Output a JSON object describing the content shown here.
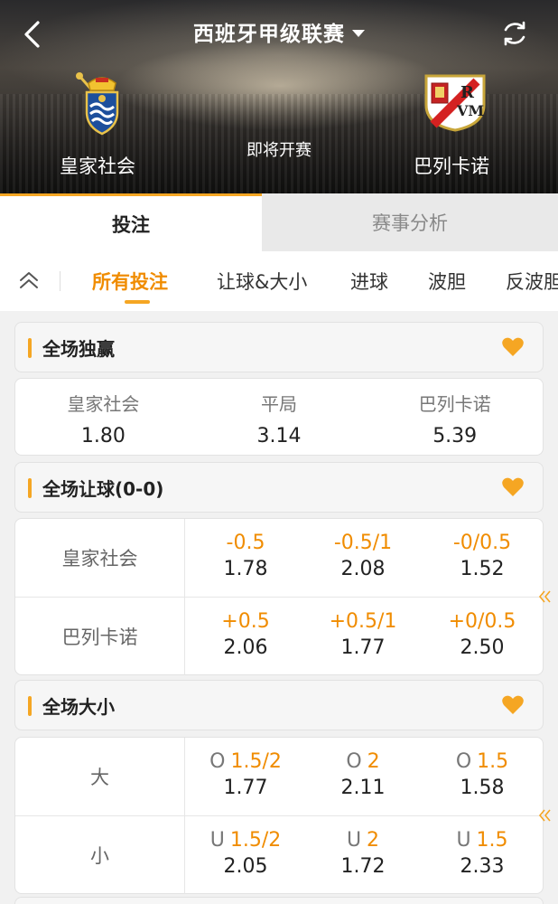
{
  "header": {
    "league": "西班牙甲级联赛",
    "home_team": "皇家社会",
    "away_team": "巴列卡诺",
    "status": "即将开赛"
  },
  "tabs": [
    "投注",
    "赛事分析"
  ],
  "sub_nav": [
    "所有投注",
    "让球&大小",
    "进球",
    "波胆",
    "反波胆"
  ],
  "colors": {
    "accent": "#f5a623",
    "line_text": "#f08c00"
  },
  "sections": {
    "moneyline": {
      "title": "全场独赢",
      "options": [
        {
          "label": "皇家社会",
          "odds": "1.80"
        },
        {
          "label": "平局",
          "odds": "3.14"
        },
        {
          "label": "巴列卡诺",
          "odds": "5.39"
        }
      ]
    },
    "handicap": {
      "title": "全场让球(0-0)",
      "rows": [
        {
          "team": "皇家社会",
          "cells": [
            {
              "line": "-0.5",
              "odds": "1.78"
            },
            {
              "line": "-0.5/1",
              "odds": "2.08"
            },
            {
              "line": "-0/0.5",
              "odds": "1.52"
            }
          ]
        },
        {
          "team": "巴列卡诺",
          "cells": [
            {
              "line": "+0.5",
              "odds": "2.06"
            },
            {
              "line": "+0.5/1",
              "odds": "1.77"
            },
            {
              "line": "+0/0.5",
              "odds": "2.50"
            }
          ]
        }
      ]
    },
    "totals": {
      "title": "全场大小",
      "rows": [
        {
          "team": "大",
          "cells": [
            {
              "prefix": "O",
              "line": "1.5/2",
              "odds": "1.77"
            },
            {
              "prefix": "O",
              "line": "2",
              "odds": "2.11"
            },
            {
              "prefix": "O",
              "line": "1.5",
              "odds": "1.58"
            }
          ]
        },
        {
          "team": "小",
          "cells": [
            {
              "prefix": "U",
              "line": "1.5/2",
              "odds": "2.05"
            },
            {
              "prefix": "U",
              "line": "2",
              "odds": "1.72"
            },
            {
              "prefix": "U",
              "line": "1.5",
              "odds": "2.33"
            }
          ]
        }
      ]
    }
  },
  "icons": [
    "back-arrow-icon",
    "caret-down-icon",
    "refresh-icon",
    "collapse-up-icon",
    "heart-icon",
    "double-chevron-left-icon"
  ]
}
